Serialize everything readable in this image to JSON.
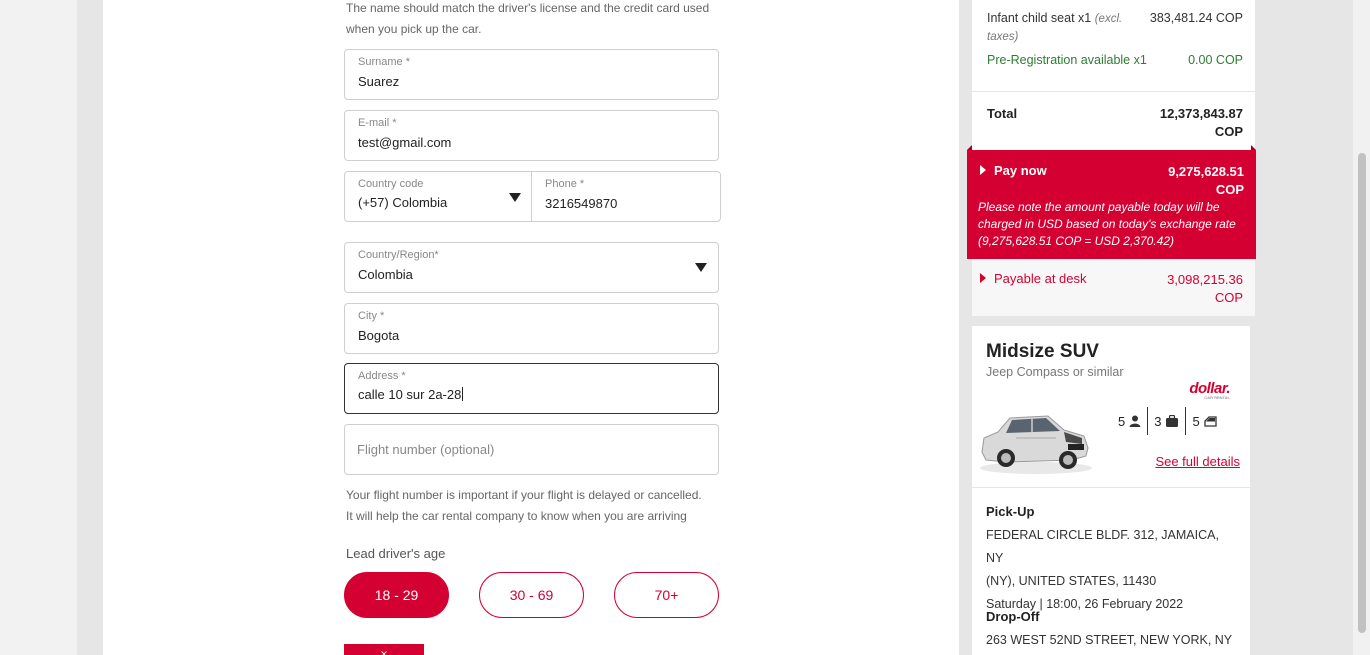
{
  "form": {
    "name_hint": [
      "The name should match the driver's license and the credit card used",
      "when you pick up the car."
    ],
    "surname": {
      "label": "Surname *",
      "value": "Suarez"
    },
    "email": {
      "label": "E-mail *",
      "value": "test@gmail.com"
    },
    "country_code": {
      "label": "Country code",
      "value": "(+57) Colombia"
    },
    "phone": {
      "label": "Phone *",
      "value": "3216549870"
    },
    "country_region": {
      "label": "Country/Region*",
      "value": "Colombia"
    },
    "city": {
      "label": "City *",
      "value": "Bogota"
    },
    "address": {
      "label": "Address *",
      "value": "calle 10 sur 2a-28"
    },
    "flight": {
      "placeholder": "Flight number (optional)"
    },
    "flight_hint": [
      "Your flight number is important if your flight is delayed or cancelled.",
      "It will help the car rental company to know when you are arriving"
    ],
    "age_label": "Lead driver's age",
    "age_options": [
      "18 - 29",
      "30 - 69",
      "70+"
    ],
    "selected_age": "18 - 29",
    "cta_partial": "×"
  },
  "summary": {
    "infant_seat": {
      "label": "Infant child seat x1",
      "note": "(excl. taxes)",
      "amount": "383,481.24 COP"
    },
    "preregistration": {
      "label": "Pre-Registration available x1",
      "amount": "0.00 COP"
    },
    "total": {
      "label": "Total",
      "amount_line1": "12,373,843.87",
      "amount_line2": "COP"
    },
    "pay_now": {
      "label": "Pay now",
      "amount_line1": "9,275,628.51",
      "amount_line2": "COP",
      "note": "Please note the amount payable today will be charged in USD based on today's exchange rate (9,275,628.51 COP = USD 2,370.42)"
    },
    "pay_desk": {
      "label": "Payable at desk",
      "amount_line1": "3,098,215.36",
      "amount_line2": "COP"
    }
  },
  "car": {
    "category": "Midsize SUV",
    "model": "Jeep Compass or similar",
    "brand": "dollar.",
    "brand_tagline": "CAR RENTAL",
    "passengers": "5",
    "bags": "3",
    "doors": "5",
    "see_details": "See full details",
    "pickup": {
      "title": "Pick-Up",
      "line1": "FEDERAL CIRCLE BLDF. 312, JAMAICA, NY",
      "line2": "(NY), UNITED STATES, 11430",
      "line3": "Saturday | 18:00, 26 February 2022"
    },
    "dropoff": {
      "title": "Drop-Off",
      "line1": "263 WEST 52ND STREET, NEW YORK, NY"
    }
  },
  "colors": {
    "accent": "#d50032",
    "success": "#2e7d32"
  },
  "icons": [
    "dropdown-caret-icon",
    "person-icon",
    "briefcase-icon",
    "car-door-icon",
    "triangle-right-icon"
  ]
}
